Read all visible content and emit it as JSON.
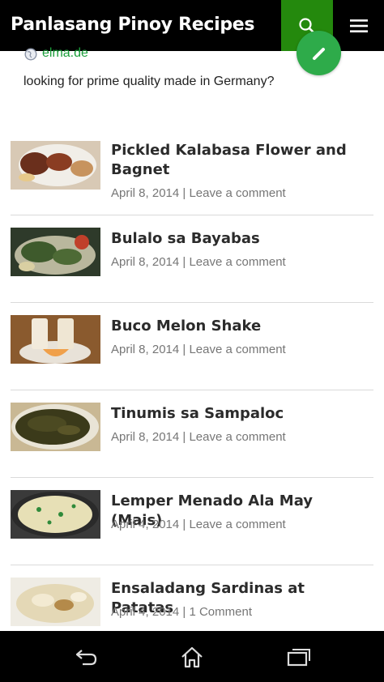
{
  "header": {
    "title": "Panlasang Pinoy Recipes"
  },
  "ad": {
    "domain": "elma.de",
    "text": "looking for prime quality made in Germany?"
  },
  "posts": [
    {
      "title": "Pickled Kalabasa Flower and Bagnet",
      "date": "April 8, 2014",
      "separator": " | ",
      "comments": "Leave a comment"
    },
    {
      "title": "Bulalo sa Bayabas",
      "date": "April 8, 2014",
      "separator": " | ",
      "comments": "Leave a comment"
    },
    {
      "title": "Buco Melon Shake",
      "date": "April 8, 2014",
      "separator": " | ",
      "comments": "Leave a comment"
    },
    {
      "title": "Tinumis sa Sampaloc",
      "date": "April 8, 2014",
      "separator": " | ",
      "comments": "Leave a comment"
    },
    {
      "title": "Lemper Menado Ala May (Mais)",
      "date": "April 4, 2014",
      "separator": " | ",
      "comments": "Leave a comment"
    },
    {
      "title": "Ensaladang Sardinas at Patatas",
      "date": "April 4, 2014",
      "separator": " | ",
      "comments": "1 Comment"
    }
  ],
  "colors": {
    "header_bg": "#000000",
    "search_bg": "#24890d",
    "ad_link": "#1a9e3a",
    "meta": "#767676"
  },
  "icons": {
    "search": "search-icon",
    "menu": "menu-icon",
    "back": "back-icon",
    "home": "home-icon",
    "recents": "recent-apps-icon"
  }
}
